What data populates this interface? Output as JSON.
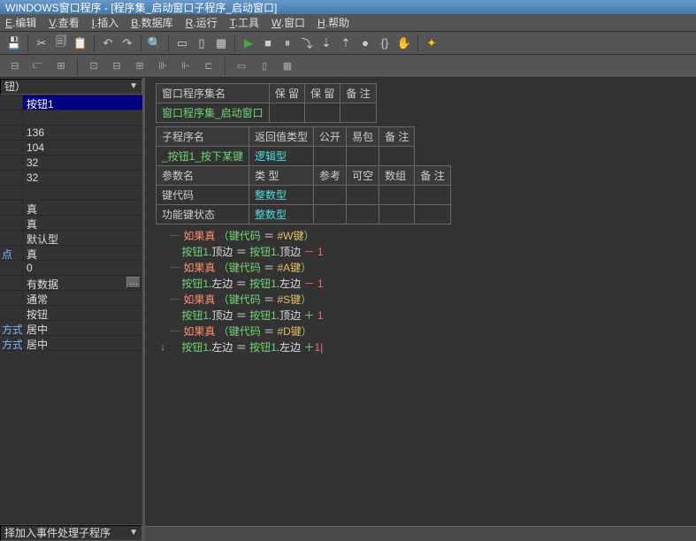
{
  "title_bar": "WINDOWS窗口程序 - [程序集_启动窗口子程序_启动窗口]",
  "menu": {
    "edit": "E.编辑",
    "view": "V.查看",
    "insert": "I.插入",
    "database": "B.数据库",
    "run": "R.运行",
    "tools": "T.工具",
    "window": "W.窗口",
    "help": "H.帮助"
  },
  "left": {
    "combo_top": "钮）",
    "properties": [
      {
        "v": "按钮1",
        "sel": true
      },
      {
        "v": ""
      },
      {
        "v": "136"
      },
      {
        "v": "104"
      },
      {
        "v": "32"
      },
      {
        "v": "32"
      },
      {
        "v": ""
      },
      {
        "v": "真"
      },
      {
        "v": "真"
      },
      {
        "v": "默认型"
      },
      {
        "lbl": "点",
        "v": "真",
        "blue": true
      },
      {
        "v": "0"
      },
      {
        "v": "有数据",
        "more": true
      },
      {
        "v": "通常"
      },
      {
        "v": "按钮"
      },
      {
        "lbl": "方式",
        "v": "居中",
        "blue": true
      },
      {
        "lbl": "方式",
        "v": "居中",
        "blue": true
      }
    ],
    "combo_bottom": "择加入事件处理子程序"
  },
  "tables": {
    "t1": {
      "headers": [
        "窗口程序集名",
        "保 留",
        "保 留",
        "备 注"
      ],
      "row": [
        "窗口程序集_启动窗口",
        "",
        "",
        ""
      ]
    },
    "t2": {
      "headers": [
        "子程序名",
        "返回值类型",
        "公开",
        "易包",
        "备 注"
      ],
      "row1": [
        "_按钮1_按下某键",
        "逻辑型",
        "",
        "",
        ""
      ],
      "headers2": [
        "参数名",
        "类 型",
        "参考",
        "可空",
        "数组",
        "备 注"
      ],
      "row2": [
        "键代码",
        "整数型",
        "",
        "",
        "",
        ""
      ],
      "row3": [
        "功能键状态",
        "整数型",
        "",
        "",
        "",
        ""
      ]
    }
  },
  "code": {
    "lines": [
      {
        "type": "if",
        "cond_var": "键代码",
        "key": "#W键"
      },
      {
        "type": "assign",
        "obj": "按钮1",
        "prop": "顶边",
        "op": "-",
        "val": "1"
      },
      {
        "type": "if",
        "cond_var": "键代码",
        "key": "#A键"
      },
      {
        "type": "assign",
        "obj": "按钮1",
        "prop": "左边",
        "op": "-",
        "val": "1"
      },
      {
        "type": "if",
        "cond_var": "键代码",
        "key": "#S键"
      },
      {
        "type": "assign",
        "obj": "按钮1",
        "prop": "顶边",
        "op": "+",
        "val": "1"
      },
      {
        "type": "if",
        "cond_var": "键代码",
        "key": "#D键"
      },
      {
        "type": "assign_cursor",
        "obj": "按钮1",
        "prop": "左边",
        "op": "+"
      }
    ],
    "kw_if": "如果真",
    "cursor": "1|"
  }
}
